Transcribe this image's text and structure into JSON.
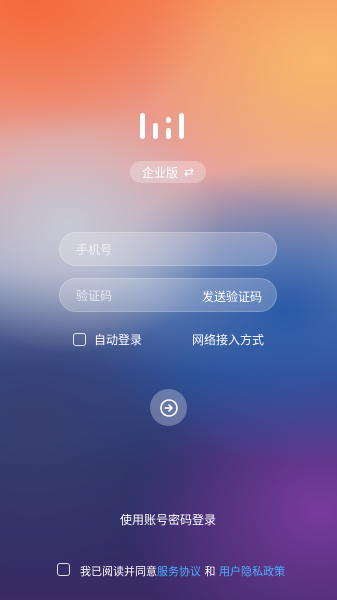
{
  "edition": {
    "label": "企业版",
    "switch_icon": "swap-icon"
  },
  "phone_field": {
    "placeholder": "手机号"
  },
  "code_field": {
    "placeholder": "验证码",
    "send_label": "发送验证码"
  },
  "options": {
    "auto_login_label": "自动登录",
    "network_label": "网络接入方式"
  },
  "login_button": {
    "icon": "arrow-in-circle-icon"
  },
  "password_login_label": "使用账号密码登录",
  "agreement": {
    "prefix": "我已阅读并同意",
    "service_link": "服务协议",
    "and": "和",
    "privacy_link": "用户隐私政策",
    "link_color": "#4fb0ff"
  }
}
